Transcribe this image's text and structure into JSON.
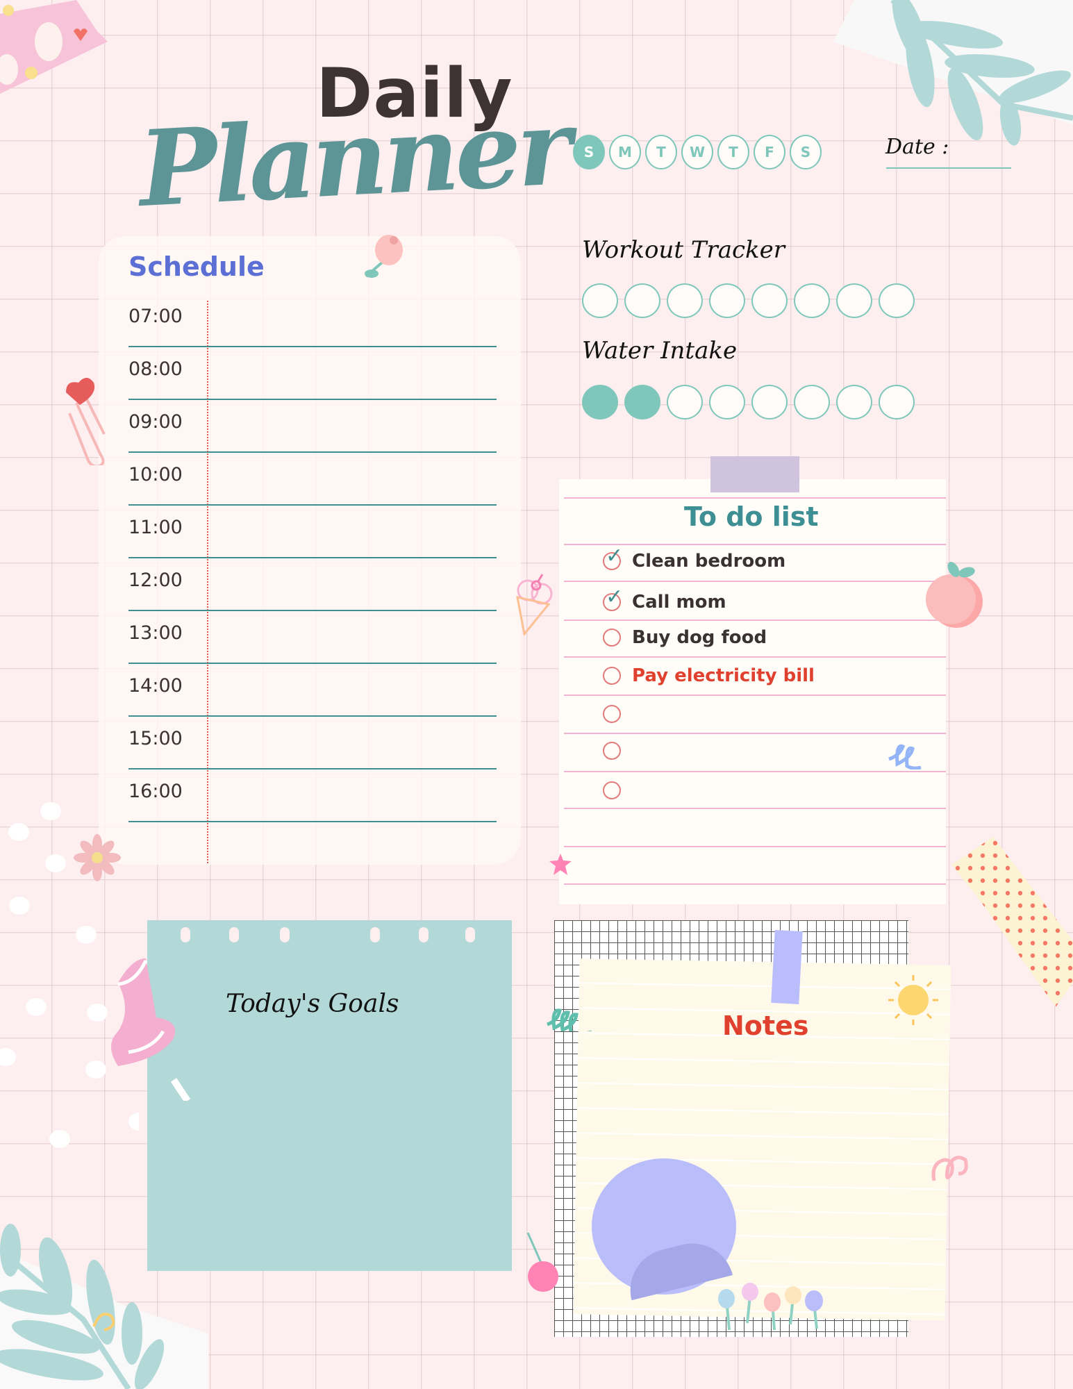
{
  "header": {
    "title_line1": "Daily",
    "title_line2": "Planner",
    "days": [
      {
        "label": "S",
        "active": true
      },
      {
        "label": "M",
        "active": false
      },
      {
        "label": "T",
        "active": false
      },
      {
        "label": "W",
        "active": false
      },
      {
        "label": "T",
        "active": false
      },
      {
        "label": "F",
        "active": false
      },
      {
        "label": "S",
        "active": false
      }
    ],
    "date_label": "Date :",
    "date_value": ""
  },
  "schedule": {
    "title": "Schedule",
    "slots": [
      "07:00",
      "08:00",
      "09:00",
      "10:00",
      "11:00",
      "12:00",
      "13:00",
      "14:00",
      "15:00",
      "16:00"
    ]
  },
  "workout_tracker": {
    "title": "Workout Tracker",
    "total": 8,
    "completed": 0
  },
  "water_intake": {
    "title": "Water Intake",
    "total": 8,
    "completed": 2
  },
  "todo": {
    "title": "To do list",
    "items": [
      {
        "text": "Clean bedroom",
        "done": true,
        "urgent": false
      },
      {
        "text": "Call mom",
        "done": true,
        "urgent": false
      },
      {
        "text": "Buy dog food",
        "done": false,
        "urgent": false
      },
      {
        "text": "Pay electricity bill",
        "done": false,
        "urgent": true
      },
      {
        "text": "",
        "done": false,
        "urgent": false
      },
      {
        "text": "",
        "done": false,
        "urgent": false
      },
      {
        "text": "",
        "done": false,
        "urgent": false
      }
    ]
  },
  "goals": {
    "title": "Today's Goals"
  },
  "notes": {
    "title": "Notes"
  },
  "colors": {
    "teal": "#7fc7ba",
    "title_teal": "#5d9596",
    "schedule_blue": "#5b6fd4",
    "urgent_red": "#e0402e",
    "background_pink": "#fdeef0"
  }
}
